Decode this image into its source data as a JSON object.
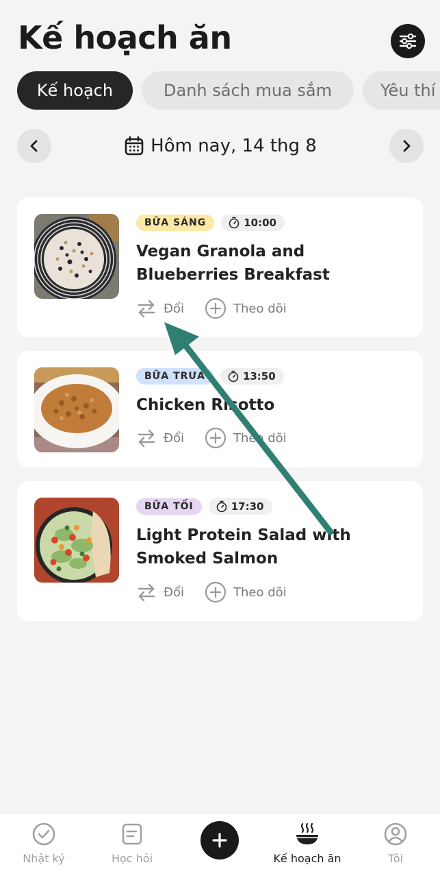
{
  "header": {
    "title": "Kế hoạch ăn",
    "filter_icon": "sliders-icon"
  },
  "tabs": [
    {
      "label": "Kế hoạch",
      "active": true
    },
    {
      "label": "Danh sách mua sắm",
      "active": false
    },
    {
      "label": "Yêu thí",
      "active": false
    }
  ],
  "date_nav": {
    "label": "Hôm nay, 14 thg 8",
    "prev_icon": "chevron-left-icon",
    "next_icon": "chevron-right-icon",
    "calendar_icon": "calendar-icon"
  },
  "meals": [
    {
      "type": "BỮA SÁNG",
      "time": "10:00",
      "title": "Vegan Granola and Blueberries Breakfast",
      "badge_color": "#fbe9a6",
      "swap_label": "Đổi",
      "track_label": "Theo dõi"
    },
    {
      "type": "BỮA TRƯA",
      "time": "13:50",
      "title": "Chicken Risotto",
      "badge_color": "#cfe1fb",
      "swap_label": "Đổi",
      "track_label": "Theo dõi"
    },
    {
      "type": "BỮA TỐI",
      "time": "17:30",
      "title": "Light Protein Salad with Smoked Salmon",
      "badge_color": "#e6d6f2",
      "swap_label": "Đổi",
      "track_label": "Theo dõi"
    }
  ],
  "bottom_nav": {
    "items": [
      {
        "label": "Nhật ký",
        "icon": "check-circle-icon",
        "active": false
      },
      {
        "label": "Học hỏi",
        "icon": "note-icon",
        "active": false
      },
      {
        "label": "",
        "icon": "plus-icon",
        "active": false
      },
      {
        "label": "Kế hoạch ăn",
        "icon": "bowl-icon",
        "active": true
      },
      {
        "label": "Tôi",
        "icon": "user-circle-icon",
        "active": false
      }
    ]
  },
  "colors": {
    "background": "#f4f4f4",
    "card": "#ffffff",
    "active_tab": "#262626",
    "annotation_arrow": "#2f7f73"
  }
}
